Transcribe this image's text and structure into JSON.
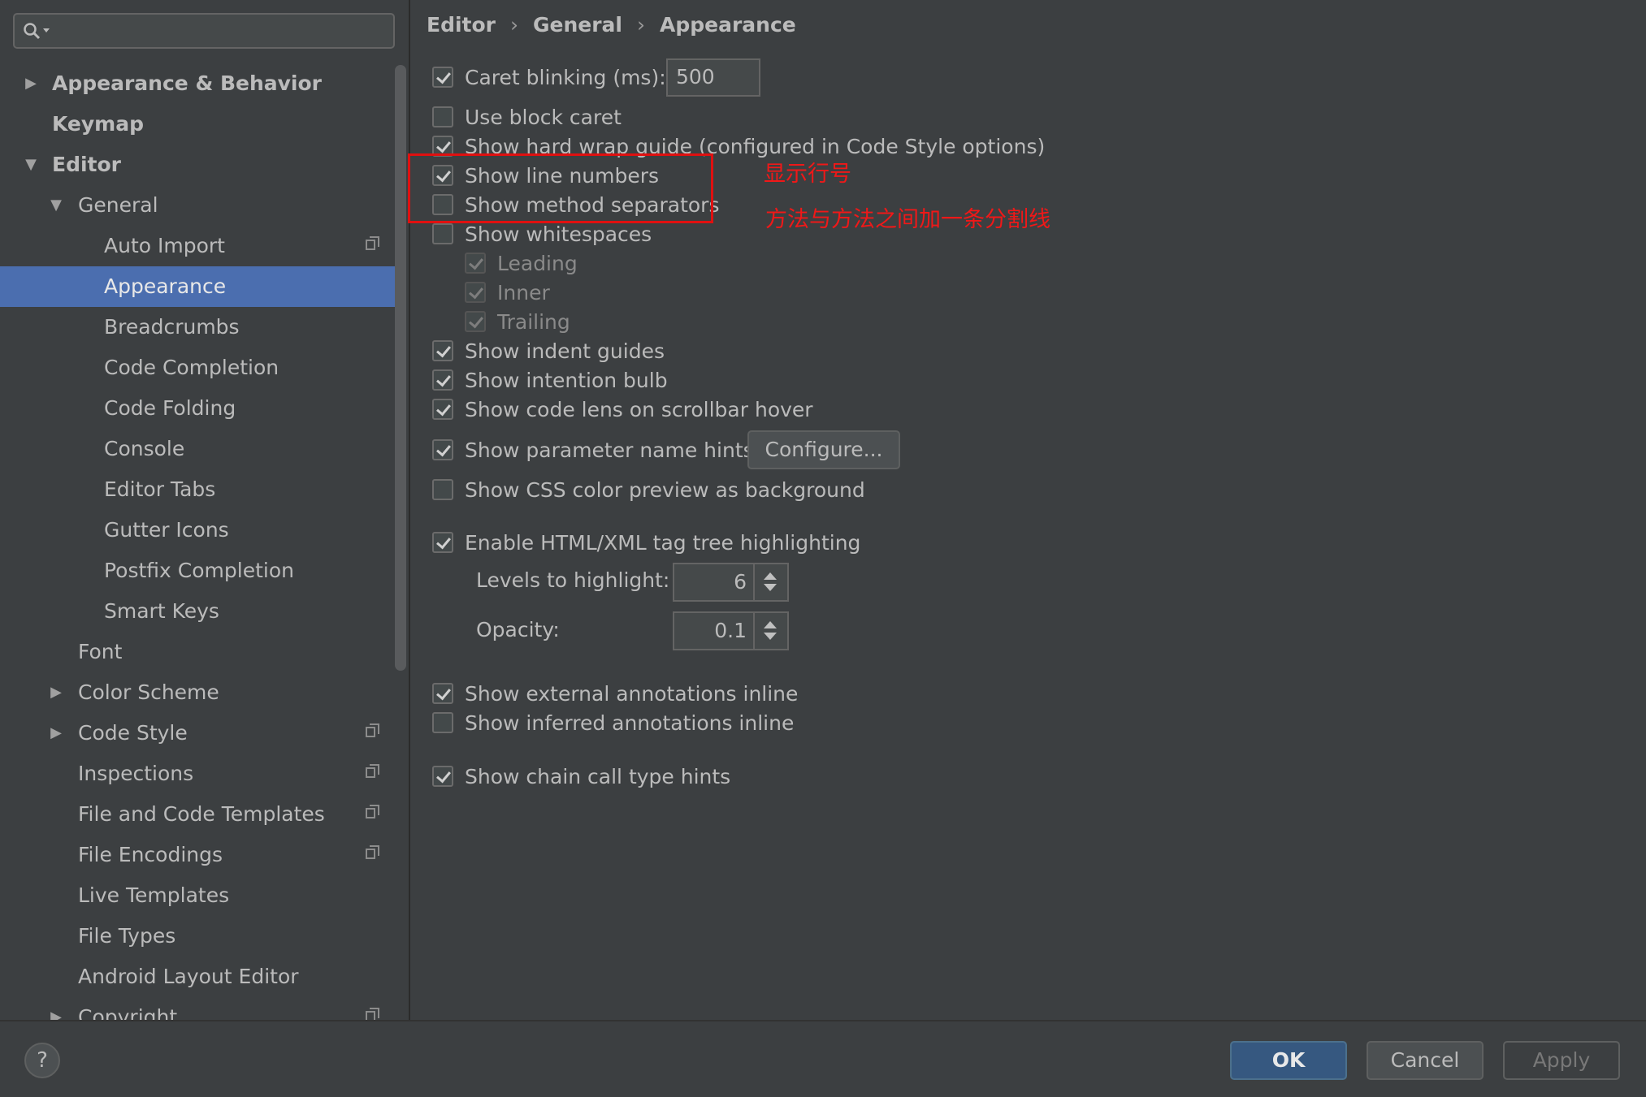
{
  "search": {
    "placeholder": ""
  },
  "sidebar": {
    "items": [
      {
        "label": "Appearance & Behavior",
        "arrow": "▶",
        "bold": true
      },
      {
        "label": "Keymap",
        "bold": true
      },
      {
        "label": "Editor",
        "arrow": "▼",
        "bold": true
      },
      {
        "label": "General",
        "arrow": "▼"
      },
      {
        "label": "Auto Import",
        "copy_icon": true
      },
      {
        "label": "Appearance",
        "selected": true
      },
      {
        "label": "Breadcrumbs"
      },
      {
        "label": "Code Completion"
      },
      {
        "label": "Code Folding"
      },
      {
        "label": "Console"
      },
      {
        "label": "Editor Tabs"
      },
      {
        "label": "Gutter Icons"
      },
      {
        "label": "Postfix Completion"
      },
      {
        "label": "Smart Keys"
      },
      {
        "label": "Font"
      },
      {
        "label": "Color Scheme",
        "arrow": "▶"
      },
      {
        "label": "Code Style",
        "arrow": "▶",
        "copy_icon": true
      },
      {
        "label": "Inspections",
        "copy_icon": true
      },
      {
        "label": "File and Code Templates",
        "copy_icon": true
      },
      {
        "label": "File Encodings",
        "copy_icon": true
      },
      {
        "label": "Live Templates"
      },
      {
        "label": "File Types"
      },
      {
        "label": "Android Layout Editor"
      },
      {
        "label": "Copyright",
        "arrow": "▶",
        "copy_icon": true
      }
    ]
  },
  "breadcrumb": [
    "Editor",
    "General",
    "Appearance"
  ],
  "options": {
    "caret_blinking": {
      "label": "Caret blinking (ms):",
      "checked": true,
      "value": "500"
    },
    "block_caret": {
      "label": "Use block caret",
      "checked": false
    },
    "hard_wrap": {
      "label": "Show hard wrap guide (configured in Code Style options)",
      "checked": true
    },
    "line_numbers": {
      "label": "Show line numbers",
      "checked": true
    },
    "method_separators": {
      "label": "Show method separators",
      "checked": false
    },
    "whitespaces": {
      "label": "Show whitespaces",
      "checked": false
    },
    "leading": {
      "label": "Leading",
      "checked": true
    },
    "inner": {
      "label": "Inner",
      "checked": true
    },
    "trailing": {
      "label": "Trailing",
      "checked": true
    },
    "indent_guides": {
      "label": "Show indent guides",
      "checked": true
    },
    "intention_bulb": {
      "label": "Show intention bulb",
      "checked": true
    },
    "code_lens": {
      "label": "Show code lens on scrollbar hover",
      "checked": true
    },
    "param_hints": {
      "label": "Show parameter name hints",
      "checked": true,
      "button": "Configure..."
    },
    "css_color": {
      "label": "Show CSS color preview as background",
      "checked": false
    },
    "html_tag_tree": {
      "label": "Enable HTML/XML tag tree highlighting",
      "checked": true
    },
    "levels": {
      "label": "Levels to highlight:",
      "value": "6"
    },
    "opacity": {
      "label": "Opacity:",
      "value": "0.1"
    },
    "external_annotations": {
      "label": "Show external annotations inline",
      "checked": true
    },
    "inferred_annotations": {
      "label": "Show inferred annotations inline",
      "checked": false
    },
    "chain_call": {
      "label": "Show chain call type hints",
      "checked": true
    }
  },
  "annotations": {
    "line_numbers_note": "显示行号",
    "separators_note": "方法与方法之间加一条分割线",
    "color": "#f01818"
  },
  "footer": {
    "help": "?",
    "ok": "OK",
    "cancel": "Cancel",
    "apply": "Apply"
  },
  "colors": {
    "background": "#3c3f41",
    "selection": "#4b6eaf",
    "primary_button": "#365880"
  }
}
